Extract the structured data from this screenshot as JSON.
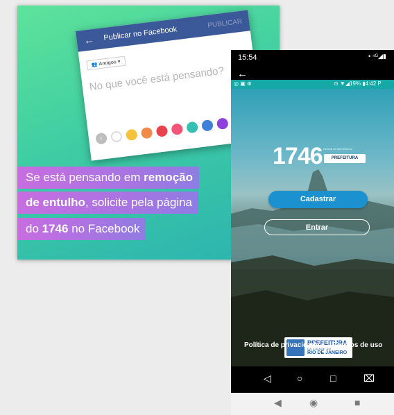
{
  "promo": {
    "fb": {
      "back": "←",
      "title": "Publicar no Facebook",
      "publish": "PUBLICAR",
      "audience": "👥 Amigos ▾",
      "prompt": "No que você está pensando?",
      "colors": [
        "#f6c23e",
        "#f08a4b",
        "#e8434b",
        "#f25578",
        "#35c0b3",
        "#3d7fd9",
        "#8e3fdc",
        "#4d5462"
      ]
    },
    "caption": {
      "l1a": "Se está pensando em ",
      "l1b": "remoção",
      "l2a": "de entulho",
      "l2b": ", solicite pela página",
      "l3a": "do ",
      "l3b": "1746",
      "l3c": " no Facebook"
    }
  },
  "phone": {
    "time": "15:54",
    "status_right": "• ⁴ᴳ◢▮",
    "back": "←",
    "inner_left": "◎ ▣ ⊛",
    "inner_right": "⊙ ▼◢19% ▮4:42 P",
    "logo_num": "1746",
    "logo_badge": "PREFEITURA",
    "logo_tiny": "Central de Atendimento",
    "btn_register": "Cadastrar",
    "btn_enter": "Entrar",
    "pref_name": "PREFEITURA",
    "pref_sub": "DA CIDADE DO",
    "pref_city": "RIO DE JANEIRO",
    "link_privacy": "Política de privacidade",
    "link_terms": "Termos de uso",
    "nav": [
      "◁",
      "○",
      "□",
      "⌧"
    ],
    "emu_nav": [
      "◀",
      "◉",
      "■"
    ]
  }
}
